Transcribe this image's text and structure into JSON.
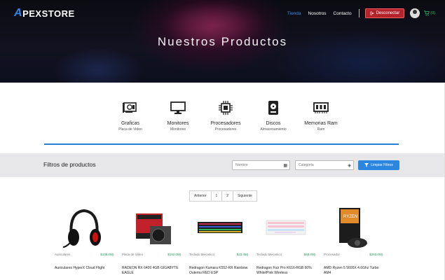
{
  "header": {
    "logo_a": "A",
    "logo_rest": "PEXSTORE",
    "nav": [
      "Tienda",
      "Nosotros",
      "Contacto"
    ],
    "logout_label": "Desconectar",
    "cart_count": "(0)",
    "hero_title": "Nuestros Productos"
  },
  "categories": [
    {
      "title": "Graficas",
      "subtitle": "Placa de Video",
      "icon": "gpu-icon"
    },
    {
      "title": "Monitores",
      "subtitle": "Monitores",
      "icon": "monitor-icon"
    },
    {
      "title": "Procesadores",
      "subtitle": "Procesadores",
      "icon": "cpu-icon"
    },
    {
      "title": "Discos",
      "subtitle": "Almacenamiento",
      "icon": "disk-icon"
    },
    {
      "title": "Memorias Ram",
      "subtitle": "Ram",
      "icon": "ram-icon"
    }
  ],
  "filters": {
    "title": "Filtros de productos",
    "name_placeholder": "Nombre",
    "category_placeholder": "Categoria",
    "clear_label": "Limpiar Filtros"
  },
  "pagination": [
    "Anterior",
    "1",
    "2",
    "Siguiente"
  ],
  "products": [
    {
      "category": "Auriculares",
      "price": "$108.000",
      "name": "Auriculares HyperX Cloud Flight"
    },
    {
      "category": "Placa de Video",
      "price": "$192.000",
      "name": "RADEON RX 6400 4GB GIGABYTE EAGLE"
    },
    {
      "category": "Teclado Mecanico",
      "price": "$33.450",
      "name": "Redragon Kumara K552-KR Rainbow Outemu RED ESP"
    },
    {
      "category": "Teclado Mecanico",
      "price": "$48.000",
      "name": "Redragon Fizz Pro K616-RGB 60% White/Pink Wireless"
    },
    {
      "category": "Procesador",
      "price": "$293.000",
      "name": "AMD Ryzen 5 5600X 4.6Ghz Turbo AM4"
    }
  ],
  "colors": {
    "accent": "#2b86e0",
    "price": "#1a9a50",
    "danger": "#b2232b"
  }
}
